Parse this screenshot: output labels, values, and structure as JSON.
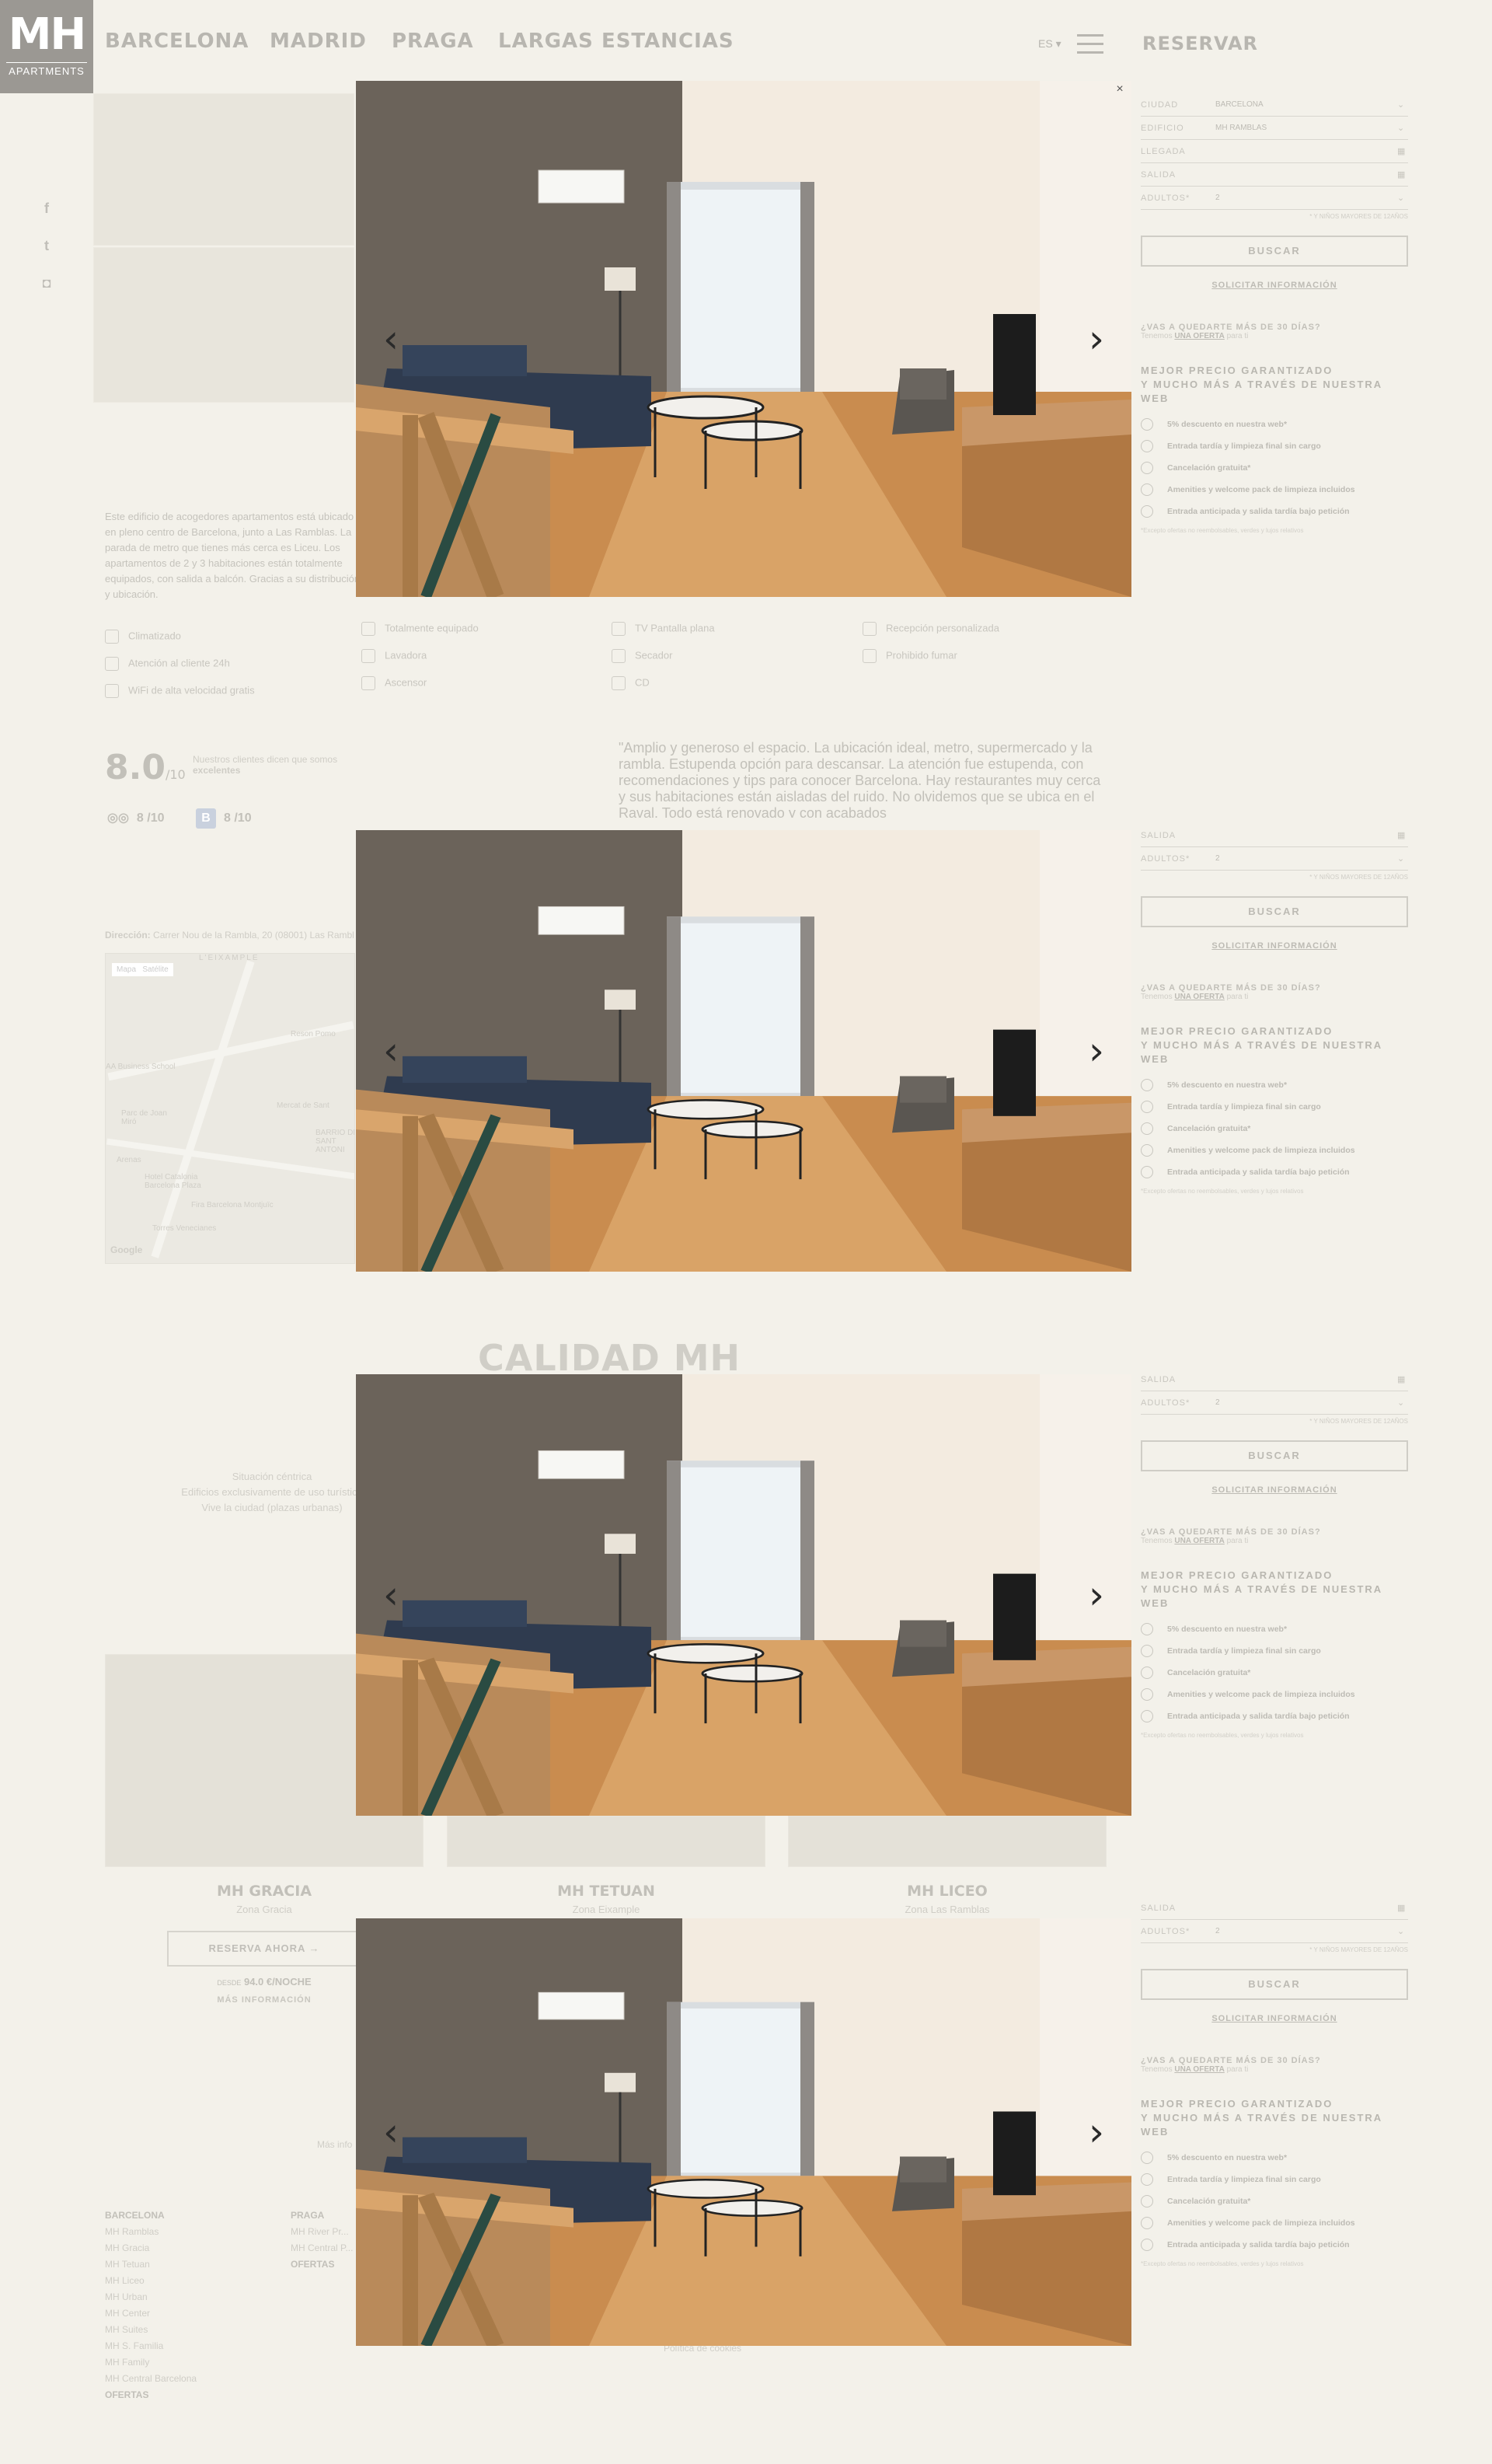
{
  "header": {
    "logo_main": "MH",
    "logo_sub": "APARTMENTS",
    "nav": [
      "BARCELONA",
      "MADRID",
      "PRAGA",
      "LARGAS ESTANCIAS"
    ],
    "lang": "ES",
    "reservar": "RESERVAR"
  },
  "social": [
    "facebook-icon",
    "twitter-icon",
    "instagram-icon"
  ],
  "lightbox": {
    "prev_icon": "chevron-left-icon",
    "next_icon": "chevron-right-icon",
    "close_icon": "close-icon",
    "prev": "‹",
    "next": "›",
    "close": "×"
  },
  "booking": {
    "ciudad_label": "CIUDAD",
    "ciudad_value": "BARCELONA",
    "edificio_label": "EDIFICIO",
    "edificio_value": "MH RAMBLAS",
    "llegada_label": "LLEGADA",
    "salida_label": "SALIDA",
    "adultos_label": "ADULTOS*",
    "adultos_value": "2",
    "ninos_note": "* Y NIÑOS MAYORES DE 12AÑOS",
    "buscar": "BUSCAR",
    "solicitar": "SOLICITAR INFORMACIÓN",
    "stay_question": "¿VAS A QUEDARTE MÁS DE 30 DÍAS?",
    "stay_pre": "Tenemos",
    "stay_link": "UNA OFERTA",
    "stay_post": "para ti",
    "best_price_1": "MEJOR PRECIO GARANTIZADO",
    "best_price_2": "Y MUCHO MÁS A TRAVÉS DE NUESTRA WEB",
    "benefits": [
      "5% descuento en nuestra web*",
      "Entrada tardía y limpieza final sin cargo",
      "Cancelación gratuita*",
      "Amenities y welcome pack de limpieza incluidos",
      "Entrada anticipada y salida tardía bajo petición"
    ],
    "footnote": "*Excepto ofertas no reembolsables, verdes y lujos relativos"
  },
  "content": {
    "description": "Este edificio de acogedores apartamentos está ubicado en pleno centro de Barcelona, junto a Las Ramblas. La parada de metro que tienes más cerca es Liceu. Los apartamentos de 2 y 3 habitaciones están totalmente equipados, con salida a balcón. Gracias a su distribución y ubicación.",
    "amenities": [
      "Climatizado",
      "Totalmente equipado",
      "TV Pantalla plana",
      "Recepción personalizada",
      "Atención al cliente 24h",
      "Lavadora",
      "Secador",
      "Prohibido fumar",
      "WiFi de alta velocidad gratis",
      "Ascensor",
      "CD"
    ],
    "score": "8.0",
    "score_suffix": "/10",
    "score_note_1": "Nuestros clientes dicen que somos",
    "score_note_2": "excelentes",
    "tripadvisor_score": "8 /10",
    "booking_badge": "B",
    "booking_score": "8 /10",
    "quote": "\"Amplio y generoso el espacio. La ubicación ideal, metro, supermercado y la rambla. Estupenda opción para descansar. La atención fue estupenda, con recomendaciones y tips para conocer Barcelona. Hay restaurantes muy cerca y sus habitaciones están aisladas del ruido. No olvidemos que se ubica en el Raval. Todo está renovado y con acabados",
    "address_label": "Dirección:",
    "address": "Carrer Nou de la Rambla, 20 (08001) Las Ramblas",
    "map_labels": [
      "Mapa",
      "Satélite",
      "L'EIXAMPLE",
      "Reson Pomo",
      "AA Business School",
      "Mercat de Sant",
      "Parc de Joan Miró",
      "BARRIO DE SANT ANTONI",
      "Arenas",
      "Hotel Catalonia Barcelona Plaza",
      "Fira Barcelona Montjuïc",
      "Torres Venecianes",
      "Google"
    ],
    "calidad": "CALIDAD MH",
    "calidad_lines": [
      "Situación céntrica",
      "Edificios exclusivamente de uso turístico",
      "Vive la ciudad (plazas urbanas)"
    ],
    "cards": [
      {
        "title": "MH GRACIA",
        "zone": "Zona Gracia"
      },
      {
        "title": "MH TETUAN",
        "zone": "Zona Eixample"
      },
      {
        "title": "MH LICEO",
        "zone": "Zona Las Ramblas"
      }
    ],
    "reserve_btn": "RESERVA AHORA →",
    "price_pre": "DESDE",
    "price": "94.0 €/NOCHE",
    "more_info": "MÁS INFORMACIÓN",
    "more_link": "Más info",
    "footer_barcelona_title": "BARCELONA",
    "footer_barcelona": [
      "MH Ramblas",
      "MH Gracia",
      "MH Tetuan",
      "MH Liceo",
      "MH Urban",
      "MH Center",
      "MH Suites",
      "MH S. Familia",
      "MH Family",
      "MH Central Barcelona"
    ],
    "footer_barcelona_offers": "OFERTAS",
    "footer_praga_title": "PRAGA",
    "footer_praga": [
      "MH River Pr...",
      "MH Central P..."
    ],
    "footer_praga_offers": "OFERTAS",
    "cookies": "Política de cookies"
  }
}
